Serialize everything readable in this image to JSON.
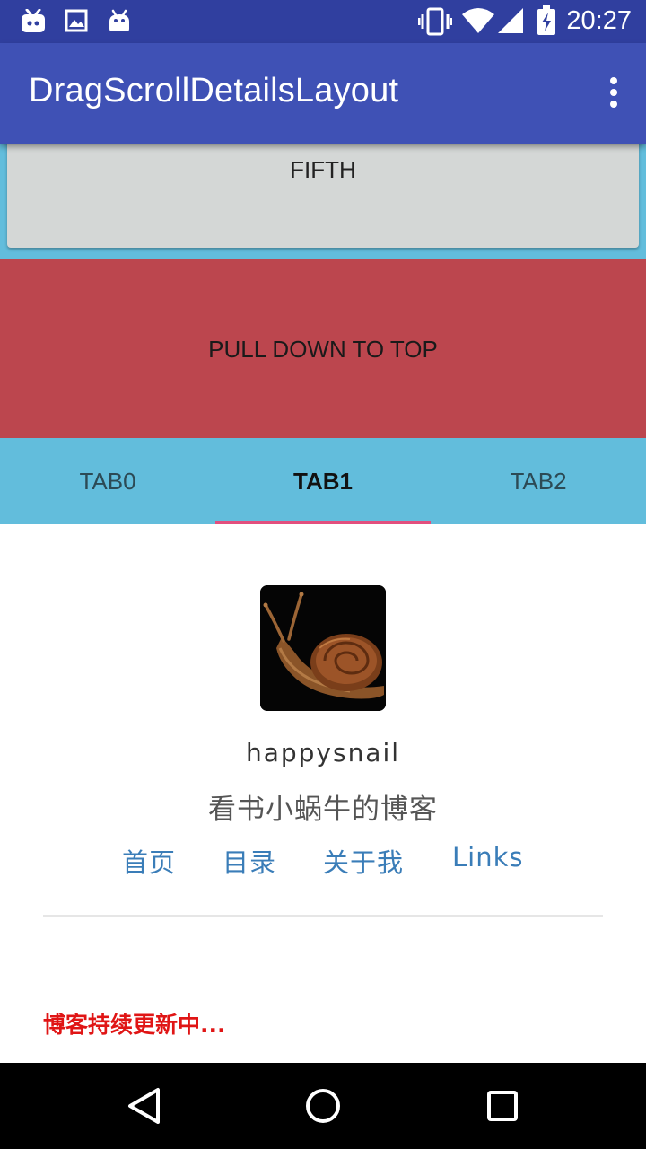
{
  "status_bar": {
    "time": "20:27",
    "left_icons": [
      "bilibili-tv-icon",
      "image-icon",
      "android-icon"
    ],
    "right_icons": [
      "vibrate-icon",
      "wifi-icon",
      "cell-signal-icon",
      "battery-charging-icon"
    ]
  },
  "app_bar": {
    "title": "DragScrollDetailsLayout",
    "overflow_icon": "more-vert-icon",
    "color": "#3F51B5"
  },
  "card": {
    "label": "FIFTH"
  },
  "pull_panel": {
    "label": "PULL DOWN TO TOP",
    "color": "#BC464E"
  },
  "tabs": {
    "items": [
      {
        "label": "TAB0"
      },
      {
        "label": "TAB1"
      },
      {
        "label": "TAB2"
      }
    ],
    "selected": "TAB1",
    "indicator_color": "#E24F7E"
  },
  "profile": {
    "avatar": "snail-avatar-image",
    "username": "happysnail",
    "subtitle": "看书小蜗牛的博客",
    "links": [
      "首页",
      "目录",
      "关于我",
      "Links"
    ],
    "link_color": "#3A7DB8"
  },
  "notice": {
    "text": "博客持续更新中...",
    "color": "#E01515"
  },
  "nav_bar": {
    "buttons": [
      "back-icon",
      "home-icon",
      "recents-icon"
    ]
  }
}
